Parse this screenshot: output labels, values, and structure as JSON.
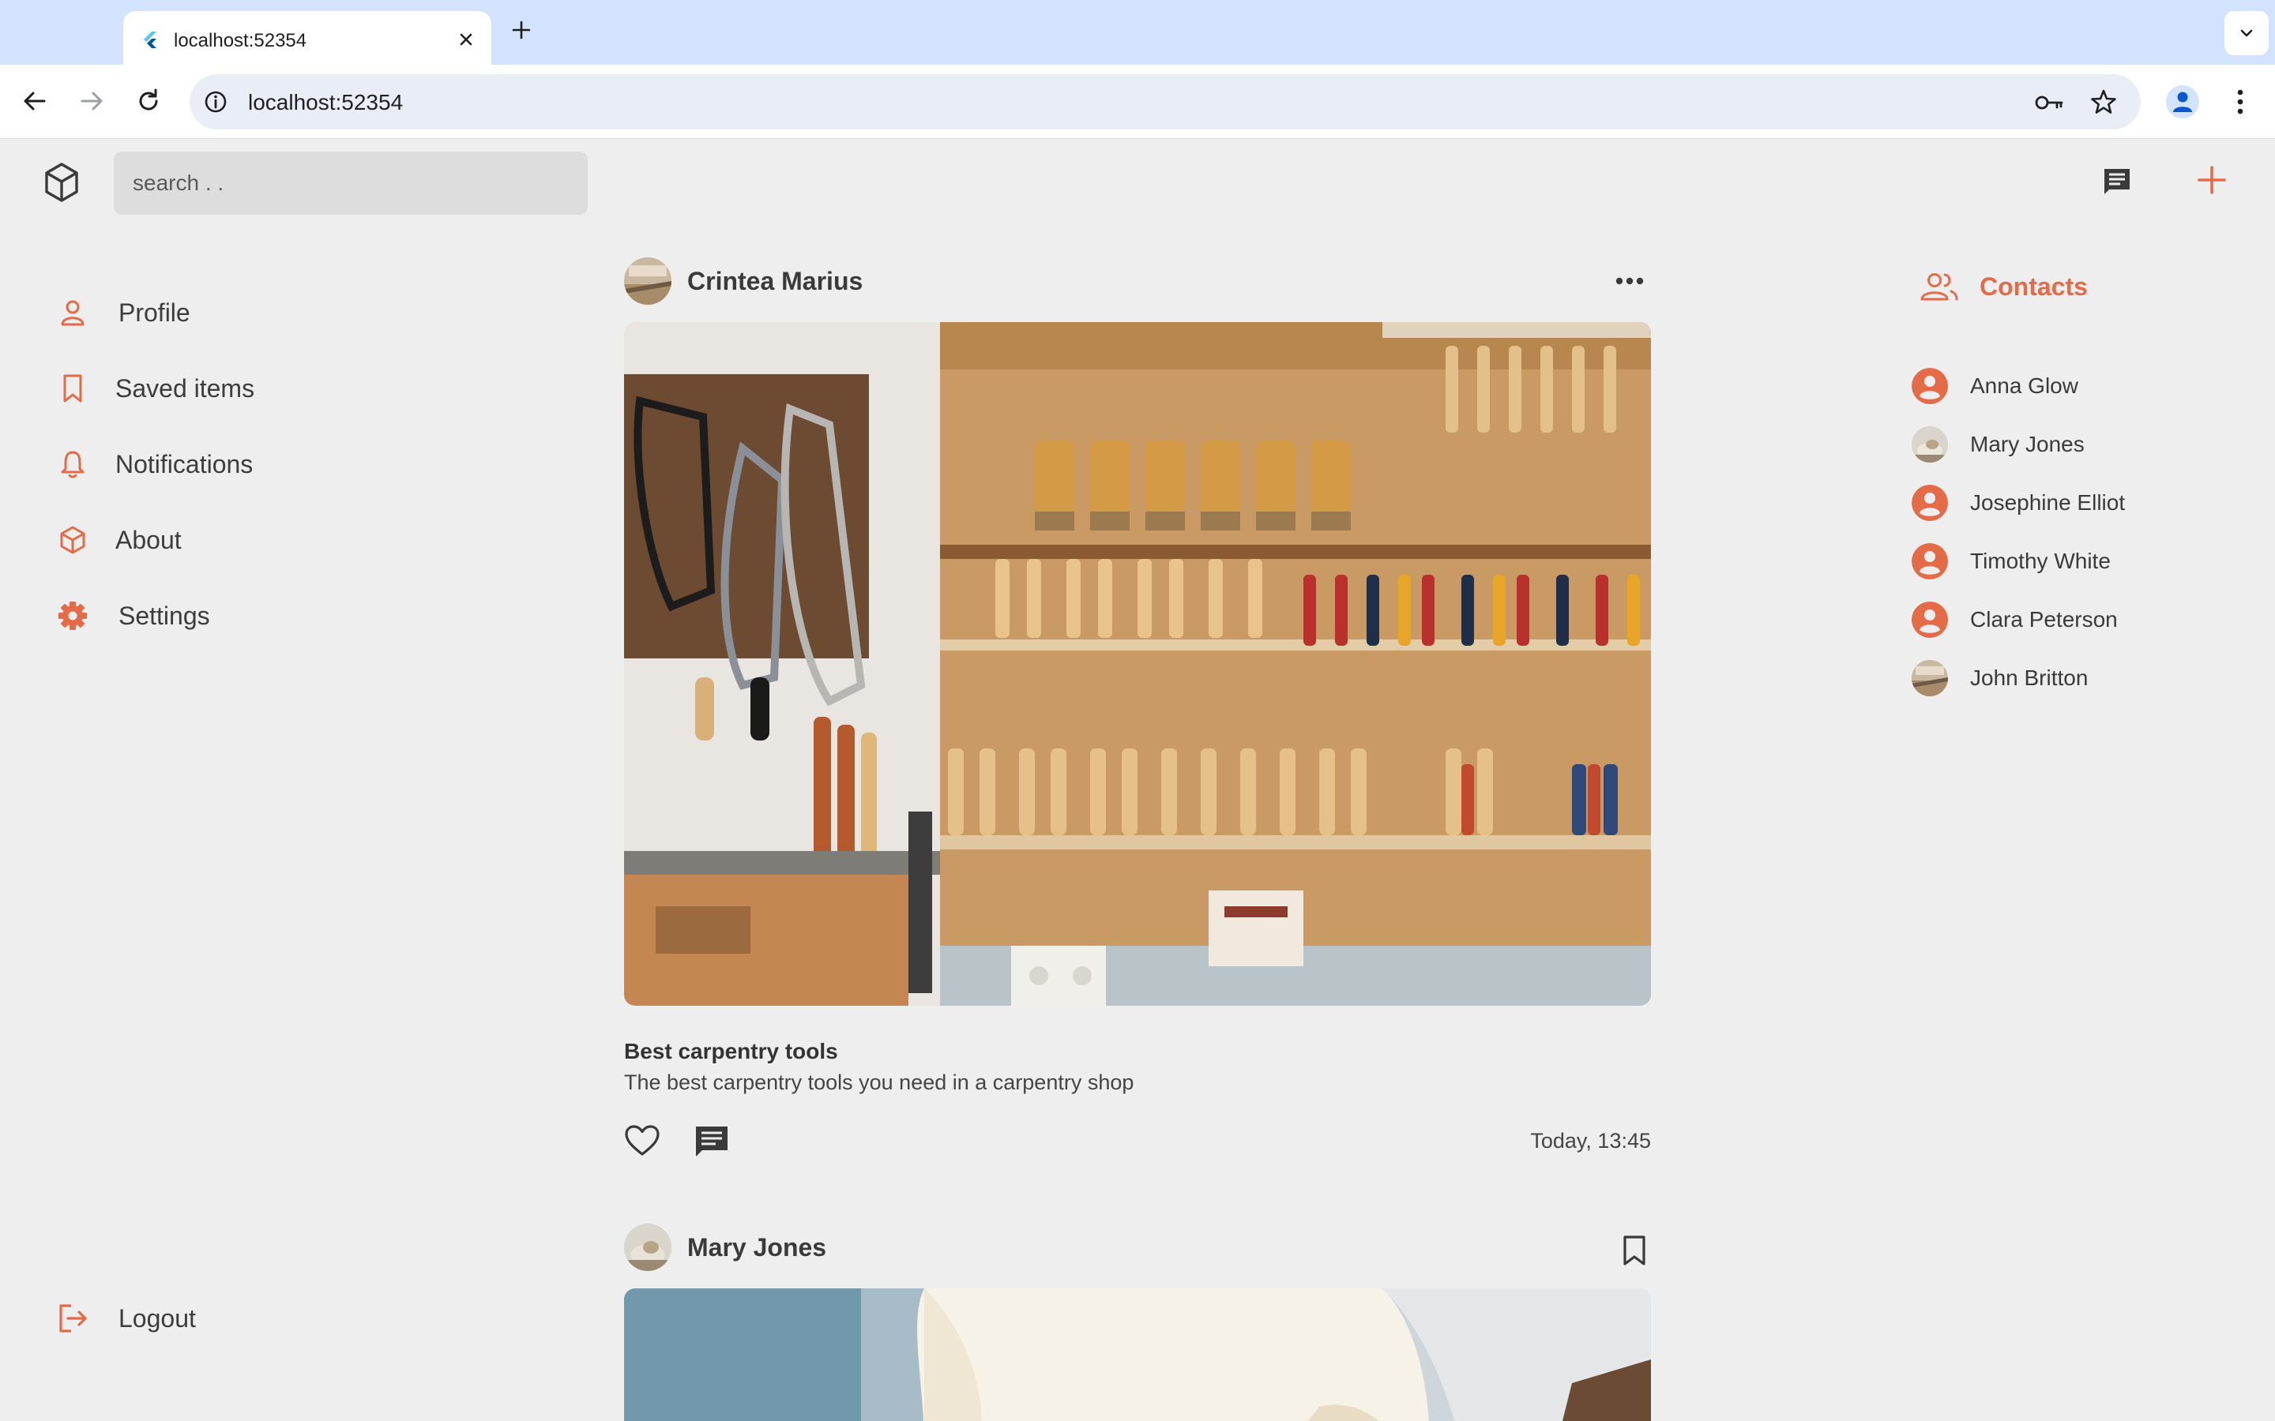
{
  "browser": {
    "tab_title": "localhost:52354",
    "url": "localhost:52354"
  },
  "app": {
    "search_placeholder": "search . .",
    "accent_color": "#e46b47"
  },
  "sidebar": {
    "items": [
      {
        "label": "Profile",
        "icon": "person-icon"
      },
      {
        "label": "Saved items",
        "icon": "bookmark-icon"
      },
      {
        "label": "Notifications",
        "icon": "bell-icon"
      },
      {
        "label": "About",
        "icon": "cube-icon"
      },
      {
        "label": "Settings",
        "icon": "gear-icon"
      }
    ],
    "logout_label": "Logout"
  },
  "feed": {
    "posts": [
      {
        "author": "Crintea Marius",
        "title": "Best carpentry tools",
        "description": "The best carpentry tools you need in a carpentry shop",
        "time": "Today, 13:45"
      },
      {
        "author": "Mary Jones"
      }
    ]
  },
  "contacts": {
    "title": "Contacts",
    "items": [
      {
        "name": "Anna Glow",
        "avatar": "default"
      },
      {
        "name": "Mary Jones",
        "avatar": "photo"
      },
      {
        "name": "Josephine Elliot",
        "avatar": "default"
      },
      {
        "name": "Timothy White",
        "avatar": "default"
      },
      {
        "name": "Clara Peterson",
        "avatar": "default"
      },
      {
        "name": "John Britton",
        "avatar": "photo"
      }
    ]
  }
}
